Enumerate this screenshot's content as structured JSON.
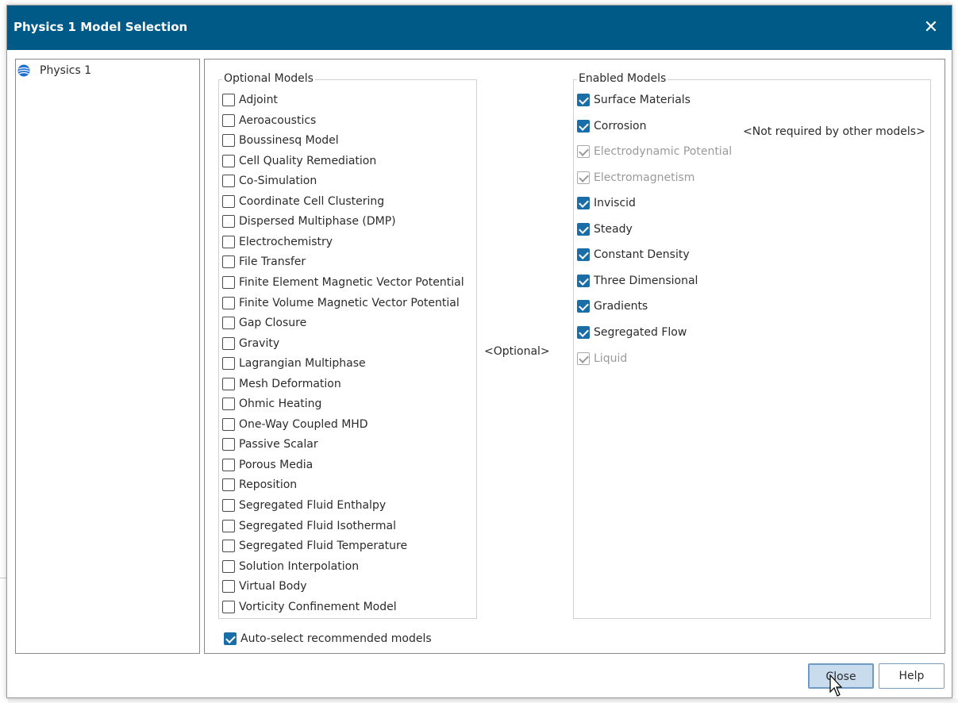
{
  "dialog": {
    "title": "Physics 1 Model Selection",
    "close_icon": "close-icon"
  },
  "tree": {
    "items": [
      {
        "label": "Physics 1",
        "icon": "physics-continuum-icon"
      }
    ]
  },
  "optional_models": {
    "legend": "Optional Models",
    "items": [
      {
        "label": "Adjoint",
        "checked": false
      },
      {
        "label": "Aeroacoustics",
        "checked": false
      },
      {
        "label": "Boussinesq Model",
        "checked": false
      },
      {
        "label": "Cell Quality Remediation",
        "checked": false
      },
      {
        "label": "Co-Simulation",
        "checked": false
      },
      {
        "label": "Coordinate Cell Clustering",
        "checked": false
      },
      {
        "label": "Dispersed Multiphase (DMP)",
        "checked": false
      },
      {
        "label": "Electrochemistry",
        "checked": false
      },
      {
        "label": "File Transfer",
        "checked": false
      },
      {
        "label": "Finite Element Magnetic Vector Potential",
        "checked": false
      },
      {
        "label": "Finite Volume Magnetic Vector Potential",
        "checked": false
      },
      {
        "label": "Gap Closure",
        "checked": false
      },
      {
        "label": "Gravity",
        "checked": false
      },
      {
        "label": "Lagrangian Multiphase",
        "checked": false
      },
      {
        "label": "Mesh Deformation",
        "checked": false
      },
      {
        "label": "Ohmic Heating",
        "checked": false
      },
      {
        "label": "One-Way Coupled MHD",
        "checked": false
      },
      {
        "label": "Passive Scalar",
        "checked": false
      },
      {
        "label": "Porous Media",
        "checked": false
      },
      {
        "label": "Reposition",
        "checked": false
      },
      {
        "label": "Segregated Fluid Enthalpy",
        "checked": false
      },
      {
        "label": "Segregated Fluid Isothermal",
        "checked": false
      },
      {
        "label": "Segregated Fluid Temperature",
        "checked": false
      },
      {
        "label": "Solution Interpolation",
        "checked": false
      },
      {
        "label": "Virtual Body",
        "checked": false
      },
      {
        "label": "Vorticity Confinement Model",
        "checked": false
      }
    ]
  },
  "middle": {
    "optional_text": "<Optional>"
  },
  "enabled_models": {
    "legend": "Enabled Models",
    "not_required_text": "<Not required by other models>",
    "items": [
      {
        "label": "Surface Materials",
        "checked": true,
        "disabled": false
      },
      {
        "label": "Corrosion",
        "checked": true,
        "disabled": false
      },
      {
        "label": "Electrodynamic Potential",
        "checked": true,
        "disabled": true
      },
      {
        "label": "Electromagnetism",
        "checked": true,
        "disabled": true
      },
      {
        "label": "Inviscid",
        "checked": true,
        "disabled": false
      },
      {
        "label": "Steady",
        "checked": true,
        "disabled": false
      },
      {
        "label": "Constant Density",
        "checked": true,
        "disabled": false
      },
      {
        "label": "Three Dimensional",
        "checked": true,
        "disabled": false
      },
      {
        "label": "Gradients",
        "checked": true,
        "disabled": false
      },
      {
        "label": "Segregated Flow",
        "checked": true,
        "disabled": false
      },
      {
        "label": "Liquid",
        "checked": true,
        "disabled": true
      }
    ]
  },
  "auto_select": {
    "label": "Auto-select recommended models",
    "checked": true
  },
  "buttons": {
    "close_label": "Close",
    "help_label": "Help"
  },
  "colors": {
    "titlebar": "#005a88",
    "checkbox_checked": "#1a6ea8",
    "disabled_text": "#9a9a9a"
  }
}
